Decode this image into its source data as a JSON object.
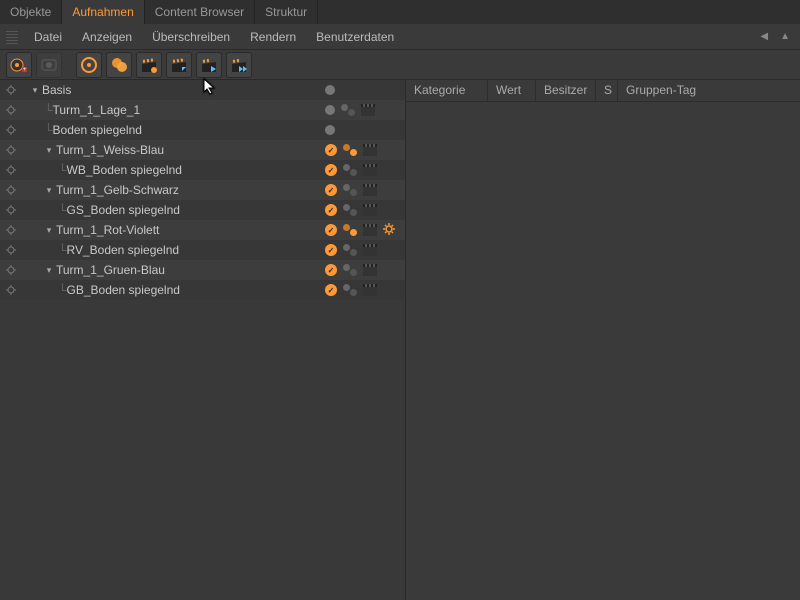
{
  "tabs": [
    {
      "label": "Objekte",
      "active": false
    },
    {
      "label": "Aufnahmen",
      "active": true
    },
    {
      "label": "Content Browser",
      "active": false
    },
    {
      "label": "Struktur",
      "active": false
    }
  ],
  "menus": [
    "Datei",
    "Anzeigen",
    "Überschreiben",
    "Rendern",
    "Benutzerdaten"
  ],
  "attr_columns": {
    "kategorie": "Kategorie",
    "wert": "Wert",
    "besitzer": "Besitzer",
    "s": "S",
    "gruppen": "Gruppen-Tag"
  },
  "tree": [
    {
      "label": "Basis",
      "depth": 0,
      "expander": "down",
      "status": "dot",
      "pair": false,
      "clap": false,
      "gear": false
    },
    {
      "label": "Turm_1_Lage_1",
      "depth": 1,
      "expander": "",
      "status": "dot",
      "pair": "grey",
      "clap": true,
      "gear": false
    },
    {
      "label": "Boden spiegelnd",
      "depth": 1,
      "expander": "",
      "status": "dot",
      "pair": false,
      "clap": false,
      "gear": false
    },
    {
      "label": "Turm_1_Weiss-Blau",
      "depth": 1,
      "expander": "down",
      "status": "check",
      "pair": "orange",
      "clap": true,
      "gear": false
    },
    {
      "label": "WB_Boden spiegelnd",
      "depth": 2,
      "expander": "",
      "status": "check",
      "pair": "grey",
      "clap": true,
      "gear": false
    },
    {
      "label": "Turm_1_Gelb-Schwarz",
      "depth": 1,
      "expander": "down",
      "status": "check",
      "pair": "grey",
      "clap": true,
      "gear": false
    },
    {
      "label": "GS_Boden spiegelnd",
      "depth": 2,
      "expander": "",
      "status": "check",
      "pair": "grey",
      "clap": true,
      "gear": false
    },
    {
      "label": "Turm_1_Rot-Violett",
      "depth": 1,
      "expander": "down",
      "status": "check",
      "pair": "orange",
      "clap": true,
      "gear": true
    },
    {
      "label": "RV_Boden spiegelnd",
      "depth": 2,
      "expander": "",
      "status": "check",
      "pair": "grey",
      "clap": true,
      "gear": false
    },
    {
      "label": "Turm_1_Gruen-Blau",
      "depth": 1,
      "expander": "down",
      "status": "check",
      "pair": "grey",
      "clap": true,
      "gear": false
    },
    {
      "label": "GB_Boden spiegelnd",
      "depth": 2,
      "expander": "",
      "status": "check",
      "pair": "grey",
      "clap": true,
      "gear": false
    }
  ]
}
